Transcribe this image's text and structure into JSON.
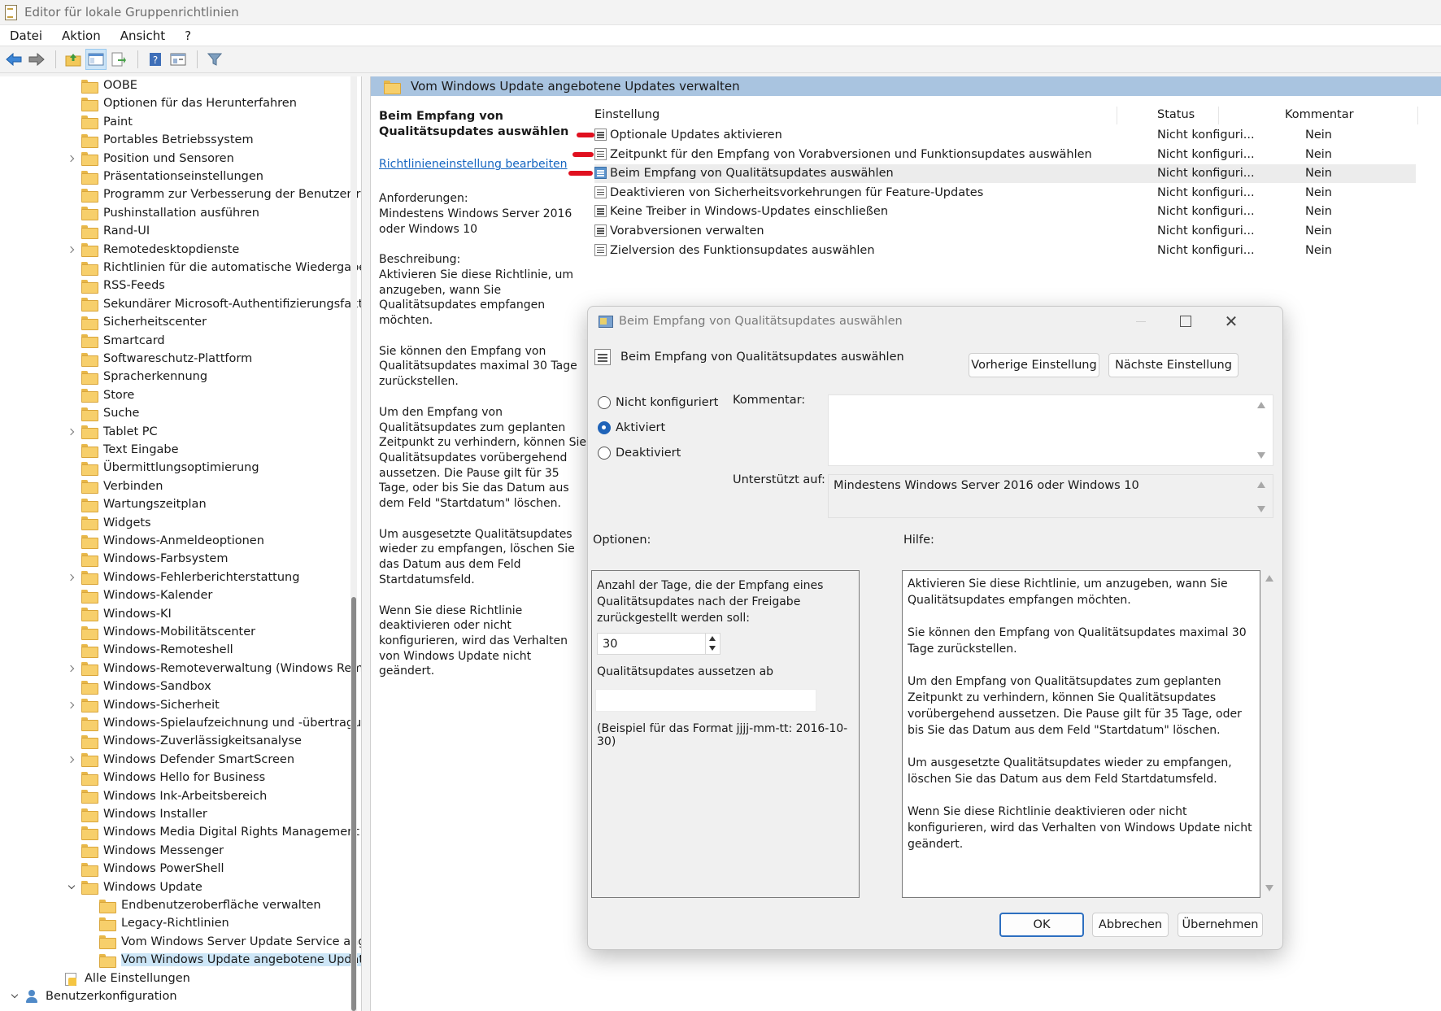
{
  "window": {
    "title": "Editor für lokale Gruppenrichtlinien"
  },
  "menu": [
    "Datei",
    "Aktion",
    "Ansicht",
    "?"
  ],
  "toolbar": {
    "buttons": [
      "back-arrow-icon",
      "forward-arrow-icon",
      "up-folder-icon",
      "show-hide-tree-icon",
      "export-list-icon",
      "help-icon",
      "properties-icon",
      "filter-icon"
    ]
  },
  "tree": {
    "items": [
      {
        "label": "OOBE",
        "chevron": "none",
        "indent": 1
      },
      {
        "label": "Optionen für das Herunterfahren",
        "chevron": "none",
        "indent": 1
      },
      {
        "label": "Paint",
        "chevron": "none",
        "indent": 1
      },
      {
        "label": "Portables Betriebssystem",
        "chevron": "none",
        "indent": 1
      },
      {
        "label": "Position und Sensoren",
        "chevron": "right",
        "indent": 1
      },
      {
        "label": "Präsentationseinstellungen",
        "chevron": "none",
        "indent": 1
      },
      {
        "label": "Programm zur Verbesserung der Benutzerfreun",
        "chevron": "none",
        "indent": 1
      },
      {
        "label": "Pushinstallation ausführen",
        "chevron": "none",
        "indent": 1
      },
      {
        "label": "Rand-UI",
        "chevron": "none",
        "indent": 1
      },
      {
        "label": "Remotedesktopdienste",
        "chevron": "right",
        "indent": 1
      },
      {
        "label": "Richtlinien für die automatische Wiedergabe",
        "chevron": "none",
        "indent": 1
      },
      {
        "label": "RSS-Feeds",
        "chevron": "none",
        "indent": 1
      },
      {
        "label": "Sekundärer Microsoft-Authentifizierungsfaktor",
        "chevron": "none",
        "indent": 1
      },
      {
        "label": "Sicherheitscenter",
        "chevron": "none",
        "indent": 1
      },
      {
        "label": "Smartcard",
        "chevron": "none",
        "indent": 1
      },
      {
        "label": "Softwareschutz-Plattform",
        "chevron": "none",
        "indent": 1
      },
      {
        "label": "Spracherkennung",
        "chevron": "none",
        "indent": 1
      },
      {
        "label": "Store",
        "chevron": "none",
        "indent": 1
      },
      {
        "label": "Suche",
        "chevron": "none",
        "indent": 1
      },
      {
        "label": "Tablet PC",
        "chevron": "right",
        "indent": 1
      },
      {
        "label": "Text Eingabe",
        "chevron": "none",
        "indent": 1
      },
      {
        "label": "Übermittlungsoptimierung",
        "chevron": "none",
        "indent": 1
      },
      {
        "label": "Verbinden",
        "chevron": "none",
        "indent": 1
      },
      {
        "label": "Wartungszeitplan",
        "chevron": "none",
        "indent": 1
      },
      {
        "label": "Widgets",
        "chevron": "none",
        "indent": 1
      },
      {
        "label": "Windows-Anmeldeoptionen",
        "chevron": "none",
        "indent": 1
      },
      {
        "label": "Windows-Farbsystem",
        "chevron": "none",
        "indent": 1
      },
      {
        "label": "Windows-Fehlerberichterstattung",
        "chevron": "right",
        "indent": 1
      },
      {
        "label": "Windows-Kalender",
        "chevron": "none",
        "indent": 1
      },
      {
        "label": "Windows-KI",
        "chevron": "none",
        "indent": 1
      },
      {
        "label": "Windows-Mobilitätscenter",
        "chevron": "none",
        "indent": 1
      },
      {
        "label": "Windows-Remoteshell",
        "chevron": "none",
        "indent": 1
      },
      {
        "label": "Windows-Remoteverwaltung (Windows Remot",
        "chevron": "right",
        "indent": 1
      },
      {
        "label": "Windows-Sandbox",
        "chevron": "none",
        "indent": 1
      },
      {
        "label": "Windows-Sicherheit",
        "chevron": "right",
        "indent": 1
      },
      {
        "label": "Windows-Spielaufzeichnung und -übertragung",
        "chevron": "none",
        "indent": 1
      },
      {
        "label": "Windows-Zuverlässigkeitsanalyse",
        "chevron": "none",
        "indent": 1
      },
      {
        "label": "Windows Defender SmartScreen",
        "chevron": "right",
        "indent": 1
      },
      {
        "label": "Windows Hello for Business",
        "chevron": "none",
        "indent": 1
      },
      {
        "label": "Windows Ink-Arbeitsbereich",
        "chevron": "none",
        "indent": 1
      },
      {
        "label": "Windows Installer",
        "chevron": "none",
        "indent": 1
      },
      {
        "label": "Windows Media Digital Rights Management (D",
        "chevron": "none",
        "indent": 1
      },
      {
        "label": "Windows Messenger",
        "chevron": "none",
        "indent": 1
      },
      {
        "label": "Windows PowerShell",
        "chevron": "none",
        "indent": 1
      },
      {
        "label": "Windows Update",
        "chevron": "down",
        "indent": 1
      },
      {
        "label": "Endbenutzeroberfläche verwalten",
        "chevron": "none",
        "indent": 2
      },
      {
        "label": "Legacy-Richtlinien",
        "chevron": "none",
        "indent": 2
      },
      {
        "label": "Vom Windows Server Update Service angeb",
        "chevron": "none",
        "indent": 2
      },
      {
        "label": "Vom Windows Update angebotene Update",
        "chevron": "none",
        "indent": 2,
        "selected": true
      },
      {
        "label": "Alle Einstellungen",
        "chevron": "none",
        "indent": 0,
        "icon": "settings"
      },
      {
        "label": "Benutzerkonfiguration",
        "chevron": "down",
        "indent": -1,
        "icon": "user"
      }
    ]
  },
  "rpane": {
    "header": "Vom Windows Update angebotene Updates verwalten",
    "desc_title": "Beim Empfang von Qualitätsupdates auswählen",
    "desc_link": "Richtlinieneinstellung bearbeiten",
    "desc_paragraphs": [
      "Anforderungen:\nMindestens Windows Server 2016 oder Windows 10",
      "Beschreibung:\nAktivieren Sie diese Richtlinie, um anzugeben, wann Sie Qualitätsupdates empfangen möchten.",
      "Sie können den Empfang von Qualitätsupdates maximal 30 Tage zurückstellen.",
      "Um den Empfang von Qualitätsupdates zum geplanten Zeitpunkt zu verhindern, können Sie Qualitätsupdates vorübergehend aussetzen. Die Pause gilt für 35 Tage, oder bis Sie das Datum aus dem Feld \"Startdatum\" löschen.",
      "Um ausgesetzte Qualitätsupdates wieder zu empfangen, löschen Sie das Datum aus dem Feld Startdatumsfeld.",
      "Wenn Sie diese Richtlinie deaktivieren oder nicht konfigurieren, wird das Verhalten von Windows Update nicht geändert."
    ],
    "columns": {
      "setting": "Einstellung",
      "status": "Status",
      "comment": "Kommentar"
    },
    "rows": [
      {
        "setting": "Optionale Updates aktivieren",
        "status": "Nicht konfiguri...",
        "comment": "Nein",
        "marked": true
      },
      {
        "setting": "Zeitpunkt für den Empfang von Vorabversionen und Funktionsupdates auswählen",
        "status": "Nicht konfiguri...",
        "comment": "Nein",
        "marked": true
      },
      {
        "setting": "Beim Empfang von Qualitätsupdates auswählen",
        "status": "Nicht konfiguri...",
        "comment": "Nein",
        "marked": true,
        "highlighted": true
      },
      {
        "setting": "Deaktivieren von Sicherheitsvorkehrungen für Feature-Updates",
        "status": "Nicht konfiguri...",
        "comment": "Nein"
      },
      {
        "setting": "Keine Treiber in Windows-Updates einschließen",
        "status": "Nicht konfiguri...",
        "comment": "Nein"
      },
      {
        "setting": "Vorabversionen verwalten",
        "status": "Nicht konfiguri...",
        "comment": "Nein"
      },
      {
        "setting": "Zielversion des Funktionsupdates auswählen",
        "status": "Nicht konfiguri...",
        "comment": "Nein"
      }
    ],
    "mark_color": "#e0101f"
  },
  "dialog": {
    "title": "Beim Empfang von Qualitätsupdates auswählen",
    "subtitle": "Beim Empfang von Qualitätsupdates auswählen",
    "prev_label": "Vorherige Einstellung",
    "next_label": "Nächste Einstellung",
    "radios": [
      {
        "label": "Nicht konfiguriert",
        "checked": false
      },
      {
        "label": "Aktiviert",
        "checked": true
      },
      {
        "label": "Deaktiviert",
        "checked": false
      }
    ],
    "comment_label": "Kommentar:",
    "comment_value": "",
    "supported_label": "Unterstützt auf:",
    "supported_value": "Mindestens Windows Server 2016 oder Windows 10",
    "options_label": "Optionen:",
    "help_label": "Hilfe:",
    "options": {
      "days_label": "Anzahl der Tage, die der Empfang eines Qualitätsupdates nach der Freigabe zurückgestellt werden soll:",
      "days_value": "30",
      "pause_label": "Qualitätsupdates aussetzen ab",
      "pause_value": "",
      "format_hint": "(Beispiel für das Format jjjj-mm-tt: 2016-10-30)"
    },
    "help_paragraphs": [
      "Aktivieren Sie diese Richtlinie, um anzugeben, wann Sie Qualitätsupdates empfangen möchten.",
      "Sie können den Empfang von Qualitätsupdates maximal 30 Tage zurückstellen.",
      "Um den Empfang von Qualitätsupdates zum geplanten Zeitpunkt zu verhindern, können Sie Qualitätsupdates vorübergehend aussetzen. Die Pause gilt für 35 Tage, oder bis Sie das Datum aus dem Feld \"Startdatum\" löschen.",
      "Um ausgesetzte Qualitätsupdates wieder zu empfangen, löschen Sie das Datum aus dem Feld Startdatumsfeld.",
      "Wenn Sie diese Richtlinie deaktivieren oder nicht konfigurieren, wird das Verhalten von Windows Update nicht geändert."
    ],
    "ok_label": "OK",
    "cancel_label": "Abbrechen",
    "apply_label": "Übernehmen",
    "accent": "#1f63b8"
  }
}
